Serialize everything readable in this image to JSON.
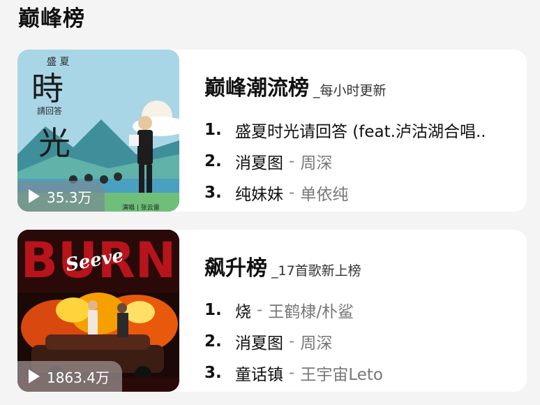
{
  "page": {
    "title": "巅峰榜"
  },
  "charts": [
    {
      "name": "巅峰潮流榜",
      "subtitle": "_每小时更新",
      "play_count": "35.3万",
      "cover_text": {
        "top": "盛 夏",
        "big1": "時",
        "mid": "請回答",
        "big2": "光",
        "credit": "演唱 | 张云雷"
      },
      "items": [
        {
          "rank": "1.",
          "song": "盛夏时光请回答 (feat.泸沽湖合唱..",
          "artist": ""
        },
        {
          "rank": "2.",
          "song": "消夏图",
          "artist": "周深"
        },
        {
          "rank": "3.",
          "song": "纯妹妹",
          "artist": "单依纯"
        }
      ]
    },
    {
      "name": "飙升榜",
      "subtitle": "_17首歌新上榜",
      "play_count": "1863.4万",
      "cover_text": {
        "big": "BURN",
        "script": "Seeve"
      },
      "items": [
        {
          "rank": "1.",
          "song": "烧",
          "artist": "王鹤棣/朴鲨"
        },
        {
          "rank": "2.",
          "song": "消夏图",
          "artist": "周深"
        },
        {
          "rank": "3.",
          "song": "童话镇",
          "artist": "王宇宙Leto"
        }
      ]
    }
  ],
  "colors": {
    "background": "#f4f4f5",
    "card": "#ffffff",
    "artist": "#777777"
  },
  "icons": {
    "play": "play-icon"
  }
}
